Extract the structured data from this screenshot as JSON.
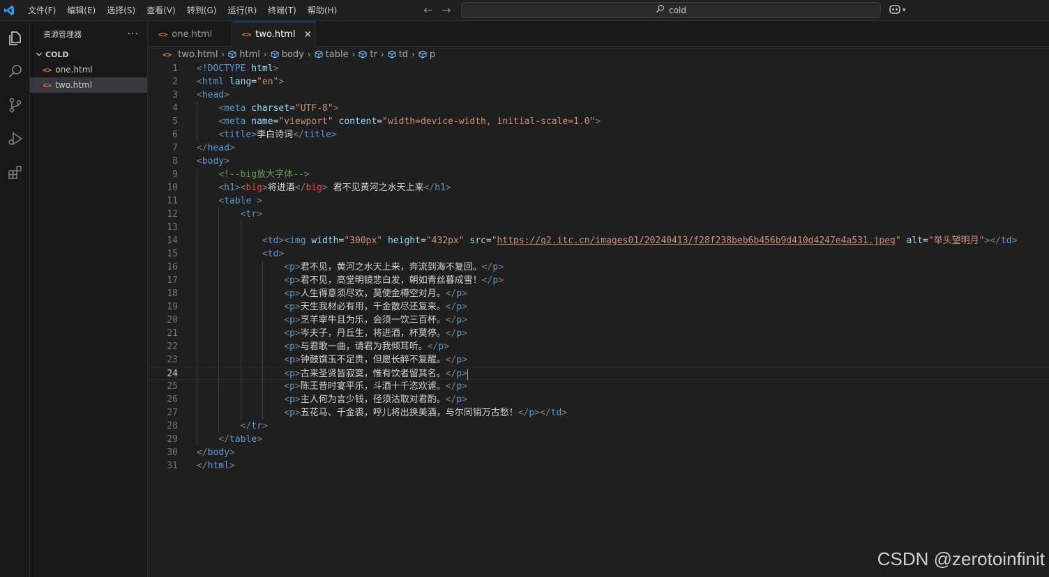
{
  "menu": [
    "文件(F)",
    "编辑(E)",
    "选择(S)",
    "查看(V)",
    "转到(G)",
    "运行(R)",
    "终端(T)",
    "帮助(H)"
  ],
  "search": {
    "text": "cold"
  },
  "sidebar": {
    "title": "资源管理器",
    "folder": "COLD",
    "files": [
      "one.html",
      "two.html"
    ]
  },
  "tabs": [
    {
      "label": "one.html",
      "active": false
    },
    {
      "label": "two.html",
      "active": true
    }
  ],
  "breadcrumb": [
    "two.html",
    "html",
    "body",
    "table",
    "tr",
    "td",
    "p"
  ],
  "editor": {
    "current_line": 24,
    "lines": [
      [
        {
          "k": "br",
          "t": "<"
        },
        {
          "k": "tag",
          "t": "!DOCTYPE"
        },
        {
          "k": "txt",
          "t": " "
        },
        {
          "k": "attr",
          "t": "html"
        },
        {
          "k": "br",
          "t": ">"
        }
      ],
      [
        {
          "k": "br",
          "t": "<"
        },
        {
          "k": "tag",
          "t": "html"
        },
        {
          "k": "txt",
          "t": " "
        },
        {
          "k": "attr",
          "t": "lang"
        },
        {
          "k": "txt",
          "t": "="
        },
        {
          "k": "str",
          "t": "\"en\""
        },
        {
          "k": "br",
          "t": ">"
        }
      ],
      [
        {
          "k": "br",
          "t": "<"
        },
        {
          "k": "tag",
          "t": "head"
        },
        {
          "k": "br",
          "t": ">"
        }
      ],
      [
        {
          "k": "txt",
          "t": "    "
        },
        {
          "k": "br",
          "t": "<"
        },
        {
          "k": "tag",
          "t": "meta"
        },
        {
          "k": "txt",
          "t": " "
        },
        {
          "k": "attr",
          "t": "charset"
        },
        {
          "k": "txt",
          "t": "="
        },
        {
          "k": "str",
          "t": "\"UTF-8\""
        },
        {
          "k": "br",
          "t": ">"
        }
      ],
      [
        {
          "k": "txt",
          "t": "    "
        },
        {
          "k": "br",
          "t": "<"
        },
        {
          "k": "tag",
          "t": "meta"
        },
        {
          "k": "txt",
          "t": " "
        },
        {
          "k": "attr",
          "t": "name"
        },
        {
          "k": "txt",
          "t": "="
        },
        {
          "k": "str",
          "t": "\"viewport\""
        },
        {
          "k": "txt",
          "t": " "
        },
        {
          "k": "attr",
          "t": "content"
        },
        {
          "k": "txt",
          "t": "="
        },
        {
          "k": "str",
          "t": "\"width=device-width, initial-scale=1.0\""
        },
        {
          "k": "br",
          "t": ">"
        }
      ],
      [
        {
          "k": "txt",
          "t": "    "
        },
        {
          "k": "br",
          "t": "<"
        },
        {
          "k": "tag",
          "t": "title"
        },
        {
          "k": "br",
          "t": ">"
        },
        {
          "k": "txt",
          "t": "李白诗词"
        },
        {
          "k": "br",
          "t": "</"
        },
        {
          "k": "tag",
          "t": "title"
        },
        {
          "k": "br",
          "t": ">"
        }
      ],
      [
        {
          "k": "br",
          "t": "</"
        },
        {
          "k": "tag",
          "t": "head"
        },
        {
          "k": "br",
          "t": ">"
        }
      ],
      [
        {
          "k": "br",
          "t": "<"
        },
        {
          "k": "tag",
          "t": "body"
        },
        {
          "k": "br",
          "t": ">"
        }
      ],
      [
        {
          "k": "txt",
          "t": "    "
        },
        {
          "k": "com",
          "t": "<!--big放大字体-->"
        }
      ],
      [
        {
          "k": "txt",
          "t": "    "
        },
        {
          "k": "br",
          "t": "<"
        },
        {
          "k": "tag",
          "t": "h1"
        },
        {
          "k": "br",
          "t": ">"
        },
        {
          "k": "br",
          "t": "<"
        },
        {
          "k": "dep",
          "t": "big"
        },
        {
          "k": "br",
          "t": ">"
        },
        {
          "k": "txt",
          "t": "将进酒"
        },
        {
          "k": "br",
          "t": "</"
        },
        {
          "k": "dep",
          "t": "big"
        },
        {
          "k": "br",
          "t": ">"
        },
        {
          "k": "txt",
          "t": " 君不见黄河之水天上来"
        },
        {
          "k": "br",
          "t": "</"
        },
        {
          "k": "tag",
          "t": "h1"
        },
        {
          "k": "br",
          "t": ">"
        }
      ],
      [
        {
          "k": "txt",
          "t": "    "
        },
        {
          "k": "br",
          "t": "<"
        },
        {
          "k": "tag",
          "t": "table"
        },
        {
          "k": "txt",
          "t": " "
        },
        {
          "k": "br",
          "t": ">"
        }
      ],
      [
        {
          "k": "txt",
          "t": "        "
        },
        {
          "k": "br",
          "t": "<"
        },
        {
          "k": "tag",
          "t": "tr"
        },
        {
          "k": "br",
          "t": ">"
        }
      ],
      [],
      [
        {
          "k": "txt",
          "t": "            "
        },
        {
          "k": "br",
          "t": "<"
        },
        {
          "k": "tag",
          "t": "td"
        },
        {
          "k": "br",
          "t": ">"
        },
        {
          "k": "br",
          "t": "<"
        },
        {
          "k": "tag",
          "t": "img"
        },
        {
          "k": "txt",
          "t": " "
        },
        {
          "k": "attr",
          "t": "width"
        },
        {
          "k": "txt",
          "t": "="
        },
        {
          "k": "str",
          "t": "\"300px\""
        },
        {
          "k": "txt",
          "t": " "
        },
        {
          "k": "attr",
          "t": "height"
        },
        {
          "k": "txt",
          "t": "="
        },
        {
          "k": "str",
          "t": "\"432px\""
        },
        {
          "k": "txt",
          "t": " "
        },
        {
          "k": "attr",
          "t": "src"
        },
        {
          "k": "txt",
          "t": "="
        },
        {
          "k": "str",
          "t": "\""
        },
        {
          "k": "link",
          "t": "https://q2.itc.cn/images01/20240413/f28f238beb6b456b9d410d4247e4a531.jpeg"
        },
        {
          "k": "str",
          "t": "\""
        },
        {
          "k": "txt",
          "t": " "
        },
        {
          "k": "attr",
          "t": "alt"
        },
        {
          "k": "txt",
          "t": "="
        },
        {
          "k": "str",
          "t": "\"举头望明月\""
        },
        {
          "k": "br",
          "t": ">"
        },
        {
          "k": "br",
          "t": "</"
        },
        {
          "k": "tag",
          "t": "td"
        },
        {
          "k": "br",
          "t": ">"
        }
      ],
      [
        {
          "k": "txt",
          "t": "            "
        },
        {
          "k": "br",
          "t": "<"
        },
        {
          "k": "tag",
          "t": "td"
        },
        {
          "k": "br",
          "t": ">"
        }
      ],
      [
        {
          "k": "txt",
          "t": "                "
        },
        {
          "k": "br",
          "t": "<"
        },
        {
          "k": "tag",
          "t": "p"
        },
        {
          "k": "br",
          "t": ">"
        },
        {
          "k": "txt",
          "t": "君不见，黄河之水天上来，奔流到海不复回。"
        },
        {
          "k": "br",
          "t": "</"
        },
        {
          "k": "tag",
          "t": "p"
        },
        {
          "k": "br",
          "t": ">"
        }
      ],
      [
        {
          "k": "txt",
          "t": "                "
        },
        {
          "k": "br",
          "t": "<"
        },
        {
          "k": "tag",
          "t": "p"
        },
        {
          "k": "br",
          "t": ">"
        },
        {
          "k": "txt",
          "t": "君不见，高堂明镜悲白发，朝如青丝暮成雪！"
        },
        {
          "k": "br",
          "t": "</"
        },
        {
          "k": "tag",
          "t": "p"
        },
        {
          "k": "br",
          "t": ">"
        }
      ],
      [
        {
          "k": "txt",
          "t": "                "
        },
        {
          "k": "br",
          "t": "<"
        },
        {
          "k": "tag",
          "t": "p"
        },
        {
          "k": "br",
          "t": ">"
        },
        {
          "k": "txt",
          "t": "人生得意须尽欢，莫使金樽空对月。"
        },
        {
          "k": "br",
          "t": "</"
        },
        {
          "k": "tag",
          "t": "p"
        },
        {
          "k": "br",
          "t": ">"
        }
      ],
      [
        {
          "k": "txt",
          "t": "                "
        },
        {
          "k": "br",
          "t": "<"
        },
        {
          "k": "tag",
          "t": "p"
        },
        {
          "k": "br",
          "t": ">"
        },
        {
          "k": "txt",
          "t": "天生我材必有用，千金散尽还复来。"
        },
        {
          "k": "br",
          "t": "</"
        },
        {
          "k": "tag",
          "t": "p"
        },
        {
          "k": "br",
          "t": ">"
        }
      ],
      [
        {
          "k": "txt",
          "t": "                "
        },
        {
          "k": "br",
          "t": "<"
        },
        {
          "k": "tag",
          "t": "p"
        },
        {
          "k": "br",
          "t": ">"
        },
        {
          "k": "txt",
          "t": "烹羊宰牛且为乐，会须一饮三百杯。"
        },
        {
          "k": "br",
          "t": "</"
        },
        {
          "k": "tag",
          "t": "p"
        },
        {
          "k": "br",
          "t": ">"
        }
      ],
      [
        {
          "k": "txt",
          "t": "                "
        },
        {
          "k": "br",
          "t": "<"
        },
        {
          "k": "tag",
          "t": "p"
        },
        {
          "k": "br",
          "t": ">"
        },
        {
          "k": "txt",
          "t": "岑夫子，丹丘生，将进酒，杯莫停。"
        },
        {
          "k": "br",
          "t": "</"
        },
        {
          "k": "tag",
          "t": "p"
        },
        {
          "k": "br",
          "t": ">"
        }
      ],
      [
        {
          "k": "txt",
          "t": "                "
        },
        {
          "k": "br",
          "t": "<"
        },
        {
          "k": "tag",
          "t": "p"
        },
        {
          "k": "br",
          "t": ">"
        },
        {
          "k": "txt",
          "t": "与君歌一曲，请君为我倾耳听。"
        },
        {
          "k": "br",
          "t": "</"
        },
        {
          "k": "tag",
          "t": "p"
        },
        {
          "k": "br",
          "t": ">"
        }
      ],
      [
        {
          "k": "txt",
          "t": "                "
        },
        {
          "k": "br",
          "t": "<"
        },
        {
          "k": "tag",
          "t": "p"
        },
        {
          "k": "br",
          "t": ">"
        },
        {
          "k": "txt",
          "t": "钟鼓馔玉不足贵，但愿长醉不复醒。"
        },
        {
          "k": "br",
          "t": "</"
        },
        {
          "k": "tag",
          "t": "p"
        },
        {
          "k": "br",
          "t": ">"
        }
      ],
      [
        {
          "k": "txt",
          "t": "                "
        },
        {
          "k": "br",
          "t": "<"
        },
        {
          "k": "tag",
          "t": "p"
        },
        {
          "k": "br",
          "t": ">"
        },
        {
          "k": "txt",
          "t": "古来圣贤皆寂寞，惟有饮者留其名。"
        },
        {
          "k": "br",
          "t": "</"
        },
        {
          "k": "tag",
          "t": "p"
        },
        {
          "k": "br",
          "t": ">"
        }
      ],
      [
        {
          "k": "txt",
          "t": "                "
        },
        {
          "k": "br",
          "t": "<"
        },
        {
          "k": "tag",
          "t": "p"
        },
        {
          "k": "br",
          "t": ">"
        },
        {
          "k": "txt",
          "t": "陈王昔时宴平乐，斗酒十千恣欢谑。"
        },
        {
          "k": "br",
          "t": "</"
        },
        {
          "k": "tag",
          "t": "p"
        },
        {
          "k": "br",
          "t": ">"
        }
      ],
      [
        {
          "k": "txt",
          "t": "                "
        },
        {
          "k": "br",
          "t": "<"
        },
        {
          "k": "tag",
          "t": "p"
        },
        {
          "k": "br",
          "t": ">"
        },
        {
          "k": "txt",
          "t": "主人何为言少钱，径须沽取对君酌。"
        },
        {
          "k": "br",
          "t": "</"
        },
        {
          "k": "tag",
          "t": "p"
        },
        {
          "k": "br",
          "t": ">"
        }
      ],
      [
        {
          "k": "txt",
          "t": "                "
        },
        {
          "k": "br",
          "t": "<"
        },
        {
          "k": "tag",
          "t": "p"
        },
        {
          "k": "br",
          "t": ">"
        },
        {
          "k": "txt",
          "t": "五花马、千金裘，呼儿将出换美酒，与尔同销万古愁！"
        },
        {
          "k": "br",
          "t": "</"
        },
        {
          "k": "tag",
          "t": "p"
        },
        {
          "k": "br",
          "t": ">"
        },
        {
          "k": "br",
          "t": "</"
        },
        {
          "k": "tag",
          "t": "td"
        },
        {
          "k": "br",
          "t": ">"
        }
      ],
      [
        {
          "k": "txt",
          "t": "        "
        },
        {
          "k": "br",
          "t": "</"
        },
        {
          "k": "tag",
          "t": "tr"
        },
        {
          "k": "br",
          "t": ">"
        }
      ],
      [
        {
          "k": "txt",
          "t": "    "
        },
        {
          "k": "br",
          "t": "</"
        },
        {
          "k": "tag",
          "t": "table"
        },
        {
          "k": "br",
          "t": ">"
        }
      ],
      [
        {
          "k": "br",
          "t": "</"
        },
        {
          "k": "tag",
          "t": "body"
        },
        {
          "k": "br",
          "t": ">"
        }
      ],
      [
        {
          "k": "br",
          "t": "</"
        },
        {
          "k": "tag",
          "t": "html"
        },
        {
          "k": "br",
          "t": ">"
        }
      ]
    ]
  },
  "watermark": "CSDN @zerotoinfinit"
}
